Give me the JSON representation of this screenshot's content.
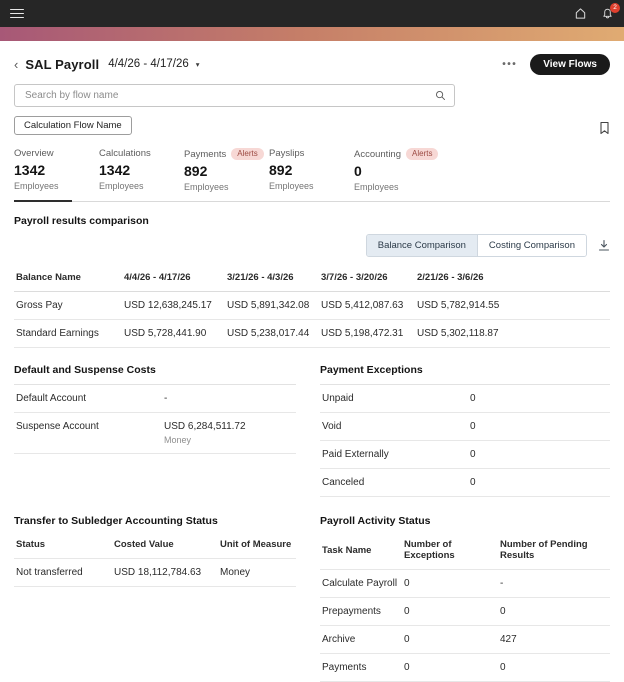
{
  "topbar": {
    "notification_count": "2"
  },
  "header": {
    "back_glyph": "‹",
    "title": "SAL Payroll",
    "date_range": "4/4/26 - 4/17/26",
    "caret_glyph": "▾",
    "more_glyph": "•••",
    "view_flows_label": "View Flows"
  },
  "search": {
    "placeholder": "Search by flow name"
  },
  "chip": {
    "label": "Calculation Flow Name"
  },
  "tabs": {
    "alerts_badge": "Alerts",
    "items": [
      {
        "label": "Overview",
        "count": "1342",
        "unit": "Employees"
      },
      {
        "label": "Calculations",
        "count": "1342",
        "unit": "Employees"
      },
      {
        "label": "Payments",
        "count": "892",
        "unit": "Employees"
      },
      {
        "label": "Payslips",
        "count": "892",
        "unit": "Employees"
      },
      {
        "label": "Accounting",
        "count": "0",
        "unit": "Employees"
      }
    ]
  },
  "comparison": {
    "title": "Payroll results comparison",
    "toggle": {
      "selected": "Balance Comparison",
      "unselected": "Costing Comparison"
    },
    "table": {
      "headers": [
        "Balance Name",
        "4/4/26 - 4/17/26",
        "3/21/26 - 4/3/26",
        "3/7/26 - 3/20/26",
        "2/21/26 - 3/6/26"
      ],
      "rows": [
        [
          "Gross Pay",
          "USD 12,638,245.17",
          "USD 5,891,342.08",
          "USD 5,412,087.63",
          "USD 5,782,914.55"
        ],
        [
          "Standard Earnings",
          "USD 5,728,441.90",
          "USD 5,238,017.44",
          "USD 5,198,472.31",
          "USD 5,302,118.87"
        ]
      ]
    }
  },
  "default_suspense": {
    "title": "Default and Suspense Costs",
    "rows": [
      {
        "label": "Default Account",
        "value": "-",
        "sub": ""
      },
      {
        "label": "Suspense Account",
        "value": "USD 6,284,511.72",
        "sub": "Money"
      }
    ]
  },
  "payment_exceptions": {
    "title": "Payment Exceptions",
    "rows": [
      {
        "label": "Unpaid",
        "value": "0"
      },
      {
        "label": "Void",
        "value": "0"
      },
      {
        "label": "Paid Externally",
        "value": "0"
      },
      {
        "label": "Canceled",
        "value": "0"
      }
    ]
  },
  "subledger": {
    "title": "Transfer to Subledger Accounting Status",
    "headers": [
      "Status",
      "Costed Value",
      "Unit of Measure"
    ],
    "rows": [
      [
        "Not transferred",
        "USD 18,112,784.63",
        "Money"
      ]
    ]
  },
  "activity": {
    "title": "Payroll Activity Status",
    "headers": [
      "Task Name",
      "Number of Exceptions",
      "Number of Pending Results"
    ],
    "rows": [
      [
        "Calculate Payroll",
        "0",
        "-"
      ],
      [
        "Prepayments",
        "0",
        "0"
      ],
      [
        "Archive",
        "0",
        "427"
      ],
      [
        "Payments",
        "0",
        "0"
      ]
    ]
  },
  "icons": {
    "menu": "hamburger-menu",
    "home": "home-outline",
    "notifications": "bell-outline",
    "search": "magnifier",
    "bookmark": "bookmark-outline",
    "download": "download-tray"
  },
  "colors": {
    "topbar_bg": "#262626",
    "gradient_left": "#a75877",
    "gradient_right": "#e0ab72",
    "notification_badge": "#e0402e",
    "alert_badge_bg": "#f7d8d5",
    "alert_badge_text": "#9c4a42",
    "toggle_selected_bg": "#e4ebf2",
    "primary_button_bg": "#1a1a1a"
  }
}
